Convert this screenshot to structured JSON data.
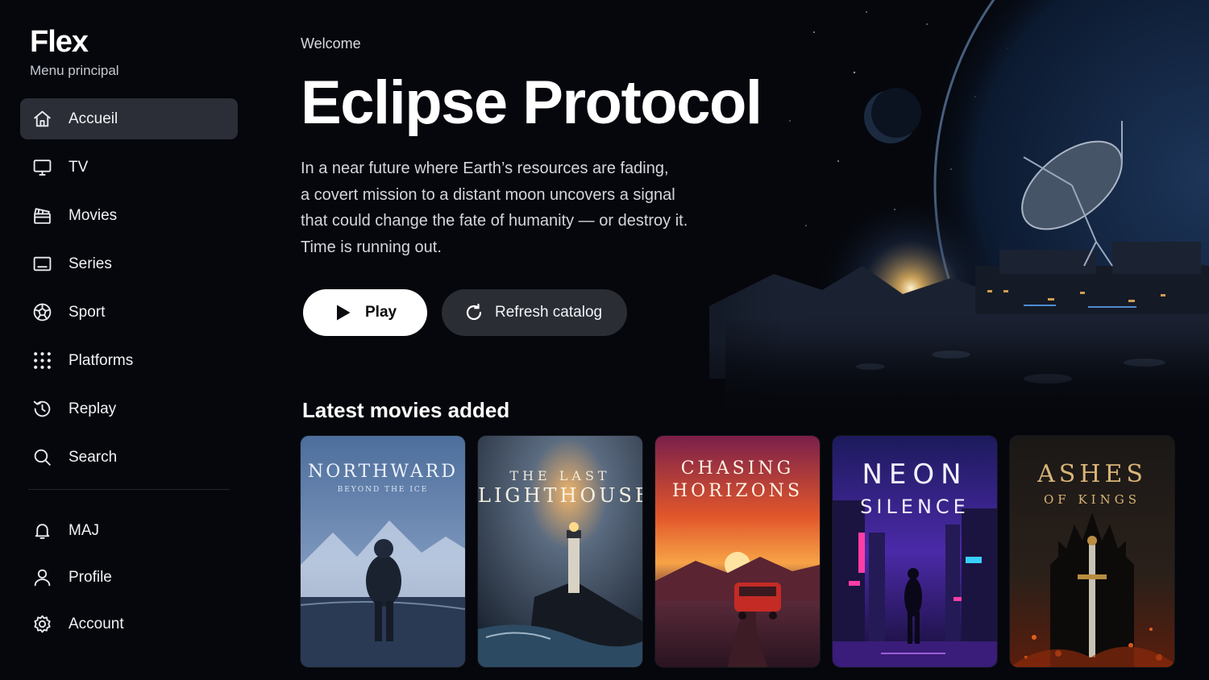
{
  "app": {
    "name": "Flex",
    "subtitle": "Menu principal"
  },
  "sidebar": {
    "items": [
      {
        "label": "Accueil",
        "icon": "home-icon",
        "active": true
      },
      {
        "label": "TV",
        "icon": "tv-icon"
      },
      {
        "label": "Movies",
        "icon": "clapperboard-icon"
      },
      {
        "label": "Series",
        "icon": "screen-icon"
      },
      {
        "label": "Sport",
        "icon": "ball-icon"
      },
      {
        "label": "Platforms",
        "icon": "grid-dots-icon"
      },
      {
        "label": "Replay",
        "icon": "history-icon"
      },
      {
        "label": "Search",
        "icon": "search-icon"
      }
    ],
    "bottom_items": [
      {
        "label": "MAJ",
        "icon": "bell-icon"
      },
      {
        "label": "Profile",
        "icon": "user-icon"
      },
      {
        "label": "Account",
        "icon": "gear-icon"
      }
    ]
  },
  "hero": {
    "welcome": "Welcome",
    "title": "Eclipse Protocol",
    "description_lines": [
      "In a near future where Earth’s resources are fading,",
      "a covert mission to a distant moon uncovers a signal",
      "that could change the fate of humanity — or destroy it.",
      "Time is running out."
    ],
    "play_label": "Play",
    "refresh_label": "Refresh catalog"
  },
  "latest": {
    "title": "Latest movies added",
    "movies": [
      {
        "title_line1": "NORTHWARD",
        "title_line2": "BEYOND THE ICE",
        "theme": "#5a7aa6"
      },
      {
        "title_line1": "THE LAST",
        "title_line2": "LIGHTHOUSE",
        "theme": "#3d5168"
      },
      {
        "title_line1": "CHASING",
        "title_line2": "HORIZONS",
        "theme": "#e2572b"
      },
      {
        "title_line1": "NEON",
        "title_line2": "SILENCE",
        "theme": "#6a2fd6"
      },
      {
        "title_line1": "ASHES",
        "title_line2": "OF KINGS",
        "theme": "#b8461d"
      }
    ]
  },
  "colors": {
    "accent": "#ffffff",
    "sidebar_active": "#2b2e36",
    "button_secondary": "#2a2d34"
  }
}
